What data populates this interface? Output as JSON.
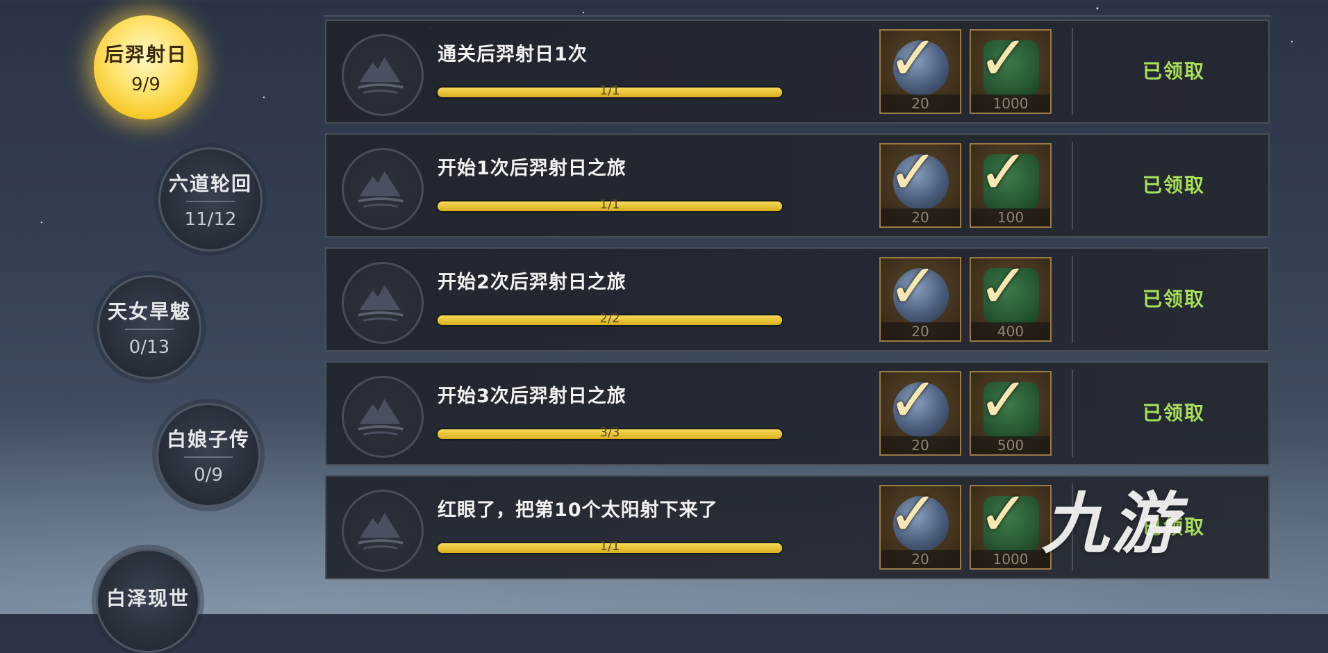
{
  "chapters": [
    {
      "name": "后羿射日",
      "count": "9/9",
      "state": "active"
    },
    {
      "name": "六道轮回",
      "count": "11/12",
      "state": "inactive"
    },
    {
      "name": "天女旱魃",
      "count": "0/13",
      "state": "inactive"
    },
    {
      "name": "白娘子传",
      "count": "0/9",
      "state": "inactive"
    },
    {
      "name": "白泽现世",
      "count": "",
      "state": "inactive"
    }
  ],
  "tasks": [
    {
      "title": "通关后羿射日1次",
      "progress_text": "1/1",
      "progress": 1.0,
      "rewards": [
        {
          "icon": "stone-icon",
          "qty": "20"
        },
        {
          "icon": "scroll-icon",
          "qty": "1000"
        }
      ],
      "status": "已领取"
    },
    {
      "title": "开始1次后羿射日之旅",
      "progress_text": "1/1",
      "progress": 1.0,
      "rewards": [
        {
          "icon": "stone-icon",
          "qty": "20"
        },
        {
          "icon": "scroll-icon",
          "qty": "100"
        }
      ],
      "status": "已领取"
    },
    {
      "title": "开始2次后羿射日之旅",
      "progress_text": "2/2",
      "progress": 1.0,
      "rewards": [
        {
          "icon": "stone-icon",
          "qty": "20"
        },
        {
          "icon": "scroll-icon",
          "qty": "400"
        }
      ],
      "status": "已领取"
    },
    {
      "title": "开始3次后羿射日之旅",
      "progress_text": "3/3",
      "progress": 1.0,
      "rewards": [
        {
          "icon": "stone-icon",
          "qty": "20"
        },
        {
          "icon": "scroll-icon",
          "qty": "500"
        }
      ],
      "status": "已领取"
    },
    {
      "title": "红眼了，把第10个太阳射下来了",
      "progress_text": "1/1",
      "progress": 1.0,
      "rewards": [
        {
          "icon": "stone-icon",
          "qty": "20"
        },
        {
          "icon": "scroll-icon",
          "qty": "1000"
        }
      ],
      "status": "已领取"
    }
  ],
  "watermark": {
    "text": "九游"
  },
  "colors": {
    "claimed": "#a8e05a",
    "progress_bar": "#e9c33a",
    "active_node": "#f4c21c"
  }
}
